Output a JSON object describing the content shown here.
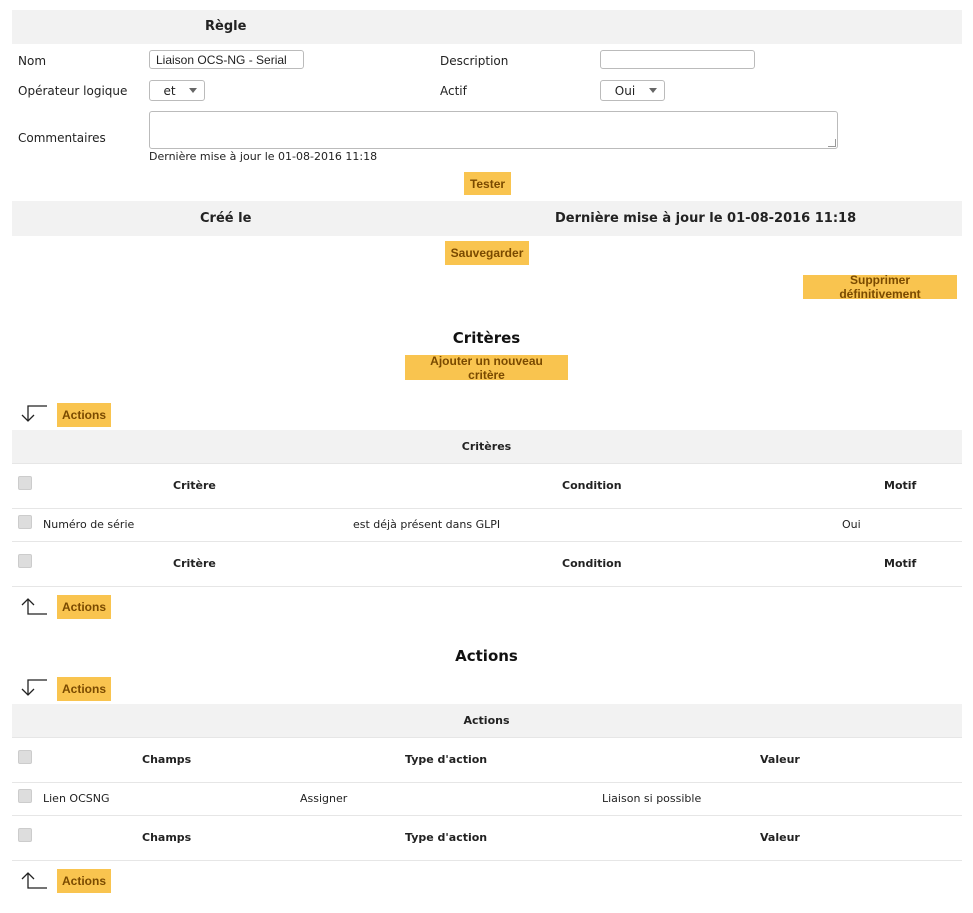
{
  "rule": {
    "header": "Règle",
    "nom_label": "Nom",
    "nom_value": "Liaison OCS-NG - Serial",
    "description_label": "Description",
    "description_value": "",
    "operator_label": "Opérateur logique",
    "operator_value": "et",
    "actif_label": "Actif",
    "actif_value": "Oui",
    "comments_label": "Commentaires",
    "comments_value": "",
    "last_update": "Dernière mise à jour le 01-08-2016 11:18",
    "test_button": "Tester"
  },
  "meta_bar": {
    "created": "Créé le",
    "updated": "Dernière mise à jour le 01-08-2016 11:18"
  },
  "buttons": {
    "save": "Sauvegarder",
    "delete": "Supprimer définitivement",
    "add_criteria": "Ajouter un nouveau critère",
    "actions": "Actions"
  },
  "criteria": {
    "title": "Critères",
    "table_title": "Critères",
    "columns": [
      "Critère",
      "Condition",
      "Motif"
    ],
    "rows": [
      {
        "critere": "Numéro de série",
        "condition": "est déjà présent dans GLPI",
        "motif": "Oui"
      }
    ]
  },
  "actions": {
    "title": "Actions",
    "table_title": "Actions",
    "columns": [
      "Champs",
      "Type d'action",
      "Valeur"
    ],
    "rows": [
      {
        "champs": "Lien OCSNG",
        "type": "Assigner",
        "valeur": "Liaison si possible"
      }
    ]
  },
  "colors": {
    "button_bg": "#f9c44f",
    "button_text": "#7a4a00",
    "header_bg": "#f2f2f2"
  }
}
